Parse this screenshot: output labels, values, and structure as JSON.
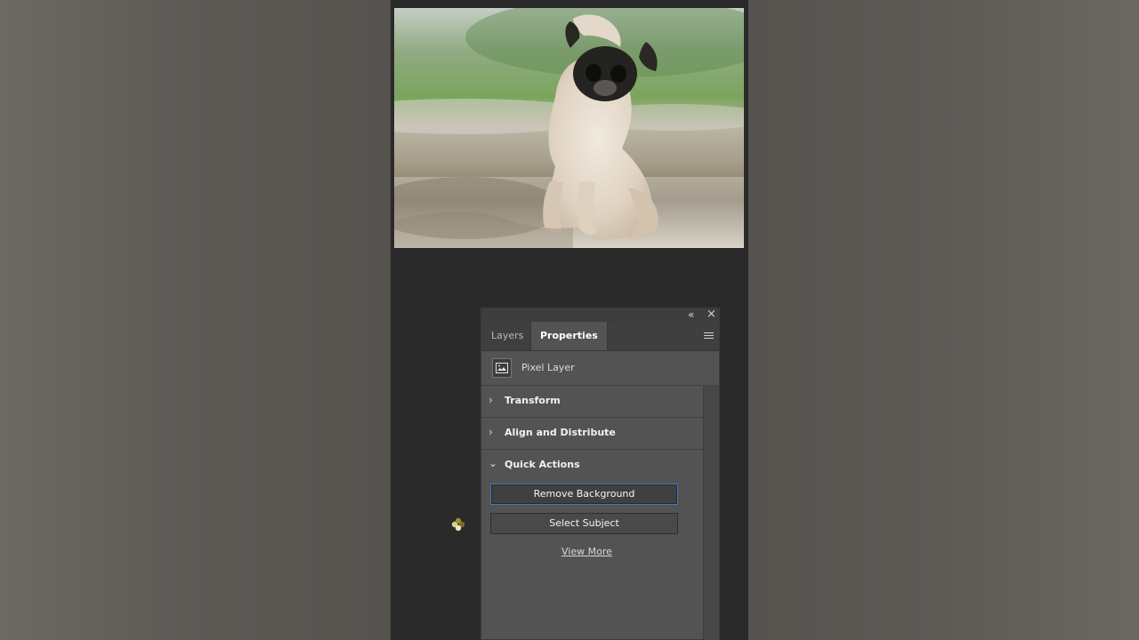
{
  "photo": {
    "subject_icon": "pug-photo"
  },
  "panel": {
    "collapse_icon": "double-chevron-left-icon",
    "close_icon": "close-icon",
    "tabs": [
      {
        "label": "Layers"
      },
      {
        "label": "Properties"
      }
    ],
    "menu_icon": "panel-menu-icon",
    "layer": {
      "icon": "image-layer-icon",
      "label": "Pixel Layer"
    },
    "sections": [
      {
        "label": "Transform",
        "icon": "chevron-right-icon"
      },
      {
        "label": "Align and Distribute",
        "icon": "chevron-right-icon"
      }
    ],
    "quick_actions": {
      "title": "Quick Actions",
      "chevron_icon": "chevron-down-icon",
      "remove_background_label": "Remove Background",
      "select_subject_label": "Select Subject",
      "view_more_label": "View More"
    }
  },
  "colors": {
    "panel_background": "#535353",
    "tab_active_background": "#535353",
    "accent_focus": "#4c73c8",
    "video_background": "#2a2a2a"
  },
  "cursor": {
    "icon": "busy-cursor-icon"
  }
}
